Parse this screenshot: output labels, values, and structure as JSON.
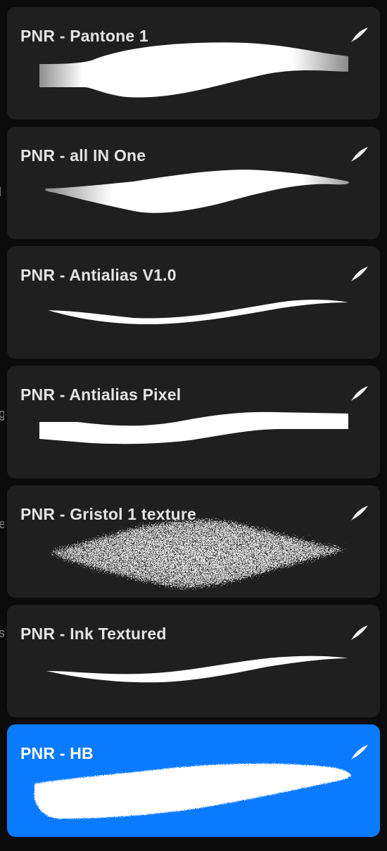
{
  "brushes": [
    {
      "name": "PNR - Pantone 1",
      "selected": false,
      "icon": "brush-stroke-icon"
    },
    {
      "name": "PNR - all IN One",
      "selected": false,
      "icon": "brush-stroke-icon"
    },
    {
      "name": "PNR - Antialias V1.0",
      "selected": false,
      "icon": "brush-stroke-icon"
    },
    {
      "name": "PNR - Antialias Pixel",
      "selected": false,
      "icon": "brush-stroke-icon"
    },
    {
      "name": "PNR - Gristol 1 texture",
      "selected": false,
      "icon": "brush-stroke-icon"
    },
    {
      "name": "PNR - Ink Textured",
      "selected": false,
      "icon": "brush-stroke-icon"
    },
    {
      "name": "PNR - HB",
      "selected": true,
      "icon": "brush-stroke-icon"
    }
  ],
  "colors": {
    "card_background": "#1f1f1f",
    "selected_background": "#0a7aff",
    "text": "#e4e4e4",
    "stroke": "#ffffff"
  }
}
